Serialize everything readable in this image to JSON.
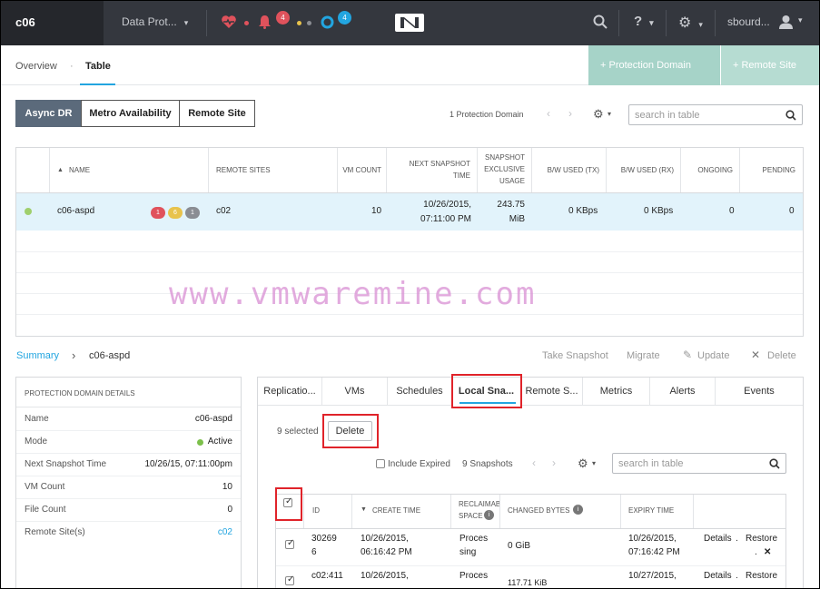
{
  "topbar": {
    "cluster_name": "c06",
    "dashboard_menu": "Data Prot...",
    "alerts_badge": "4",
    "tasks_badge": "4",
    "user_name": "sbourd...",
    "help_label": "?"
  },
  "subnav": {
    "tabs": [
      {
        "label": "Overview"
      },
      {
        "label": "Table"
      }
    ],
    "separator": "·",
    "protection_domain_button": "+ Protection Domain",
    "remote_site_button": "+ Remote Site"
  },
  "toolbar": {
    "segments": [
      {
        "label": "Async DR"
      },
      {
        "label": "Metro Availability"
      },
      {
        "label": "Remote Site"
      }
    ],
    "count_text": "1 Protection Domain",
    "search_placeholder": "search in table"
  },
  "pd_table": {
    "headers": [
      "NAME",
      "REMOTE SITES",
      "VM COUNT",
      "NEXT SNAPSHOT TIME",
      "SNAPSHOT EXCLUSIVE USAGE",
      "B/W USED (TX)",
      "B/W USED (RX)",
      "ONGOING",
      "PENDING"
    ],
    "sort_indicator": "▲",
    "rows": [
      {
        "name": "c06-aspd",
        "badges": [
          "1",
          "6",
          "1"
        ],
        "remote_sites": "c02",
        "vm_count": "10",
        "next_snapshot_time": "10/26/2015, 07:11:00 PM",
        "snapshot_usage": "243.75 MiB",
        "bw_tx": "0 KBps",
        "bw_rx": "0 KBps",
        "ongoing": "0",
        "pending": "0"
      }
    ]
  },
  "watermark": "www.vmwaremine.com",
  "details": {
    "breadcrumb_summary": "Summary",
    "breadcrumb_sep": "›",
    "breadcrumb_item": "c06-aspd",
    "actions": {
      "take_snapshot": "Take Snapshot",
      "migrate": "Migrate",
      "update": "Update",
      "delete": "Delete"
    }
  },
  "pd_details": {
    "header": "PROTECTION DOMAIN DETAILS",
    "rows": [
      {
        "key": "Name",
        "value": "c06-aspd"
      },
      {
        "key": "Mode",
        "value": "Active"
      },
      {
        "key": "Next Snapshot Time",
        "value": "10/26/15, 07:11:00pm"
      },
      {
        "key": "VM Count",
        "value": "10"
      },
      {
        "key": "File Count",
        "value": "0"
      },
      {
        "key": "Remote Site(s)",
        "value": "c02"
      }
    ]
  },
  "panel": {
    "tabs": [
      "Replicatio...",
      "VMs",
      "Schedules",
      "Local Sna...",
      "Remote S...",
      "Metrics",
      "Alerts",
      "Events"
    ],
    "selected_text": "9 selected",
    "delete_button": "Delete",
    "include_expired_label": "Include Expired",
    "snapshots_count": "9 Snapshots",
    "search_placeholder": "search in table",
    "headers": [
      "ID",
      "CREATE TIME",
      "RECLAIMABLE SPACE",
      "CHANGED BYTES",
      "EXPIRY TIME"
    ],
    "reclaimable_display": "RECLAIMAB",
    "space_display": "SPACE",
    "sort_indicator": "▼",
    "info_glyph": "i",
    "rows": [
      {
        "id_line1": "30269",
        "id_line2": "6",
        "create_line1": "10/26/2015,",
        "create_line2": "06:16:42 PM",
        "reclaim_line1": "Proces",
        "reclaim_line2": "sing",
        "changed": "0 GiB",
        "expiry_line1": "10/26/2015,",
        "expiry_line2": "07:16:42 PM",
        "details": "Details",
        "dot": ".",
        "restore": "Restore",
        "dot2": ".",
        "remove": "✕"
      },
      {
        "id_line1": "c02:411",
        "id_line2": "",
        "create_line1": "10/26/2015,",
        "create_line2": "",
        "reclaim_line1": "Proces",
        "reclaim_line2": "",
        "changed": "117.71 KiB",
        "expiry_line1": "10/27/2015,",
        "expiry_line2": "",
        "details": "Details",
        "dot": ".",
        "restore": "Restore",
        "dot2": "",
        "remove": ""
      }
    ]
  },
  "colors": {
    "topbar": "#34373e",
    "accent": "#22a5e0",
    "green_button": "#a6d3c8",
    "highlight": "#e0232a",
    "active_green": "#7cc04b"
  }
}
